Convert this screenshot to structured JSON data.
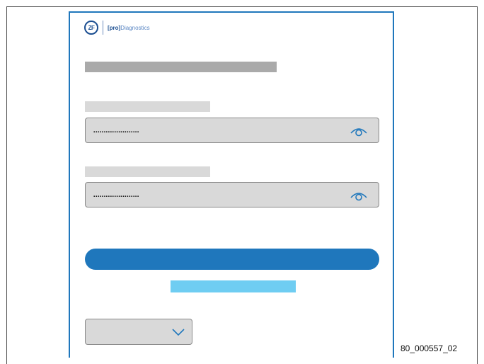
{
  "header": {
    "logo_mark": "ZF",
    "brand_pro": "[pro]",
    "brand_name": "Diagnostics"
  },
  "form": {
    "password_field_1": {
      "value": "......................",
      "toggle_icon": "eye-icon"
    },
    "password_field_2": {
      "value": "......................",
      "toggle_icon": "eye-icon"
    },
    "select": {
      "icon": "chevron-down-icon"
    }
  },
  "colors": {
    "accent": "#1f77bc",
    "link": "#6fcdf2",
    "field_bg": "#d9d9d9",
    "heading_placeholder": "#aaaaaa"
  },
  "figure_id": "80_000557_02"
}
